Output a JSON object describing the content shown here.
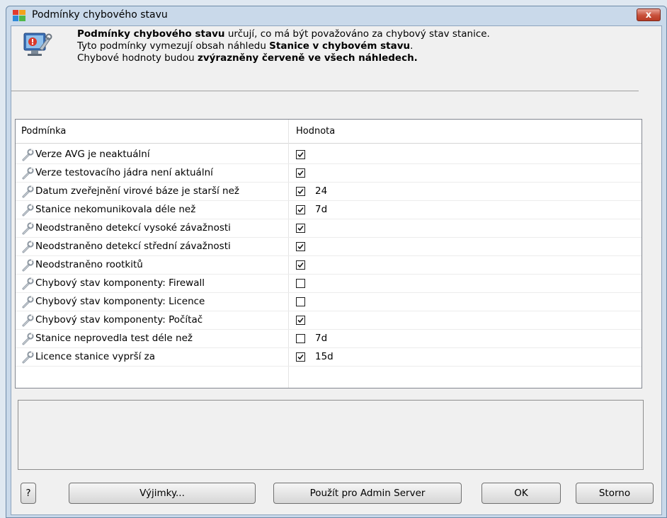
{
  "window": {
    "title": "Podmínky chybového stavu",
    "close_symbol": "x"
  },
  "intro": {
    "line1_bold": "Podmínky chybového stavu",
    "line1_rest": " určují, co má být považováno za chybový stav stanice.",
    "line2_rest": "Tyto podmínky vymezují obsah náhledu ",
    "line2_bold": "Stanice v chybovém stavu",
    "line2_end": ".",
    "line3_rest": "Chybové hodnoty budou ",
    "line3_bold": "zvýrazněny červeně ve všech náhledech."
  },
  "table": {
    "columns": [
      "Podmínka",
      "Hodnota"
    ],
    "rows": [
      {
        "condition": "Verze AVG je neaktuální",
        "checked": true,
        "value": ""
      },
      {
        "condition": "Verze testovacího jádra není aktuální",
        "checked": true,
        "value": ""
      },
      {
        "condition": "Datum zveřejnění virové báze je starší než",
        "checked": true,
        "value": "24"
      },
      {
        "condition": "Stanice nekomunikovala déle než",
        "checked": true,
        "value": "7d"
      },
      {
        "condition": "Neodstraněno detekcí vysoké závažnosti",
        "checked": true,
        "value": ""
      },
      {
        "condition": "Neodstraněno detekcí střední závažnosti",
        "checked": true,
        "value": ""
      },
      {
        "condition": "Neodstraněno rootkitů",
        "checked": true,
        "value": ""
      },
      {
        "condition": "Chybový stav komponenty: Firewall",
        "checked": false,
        "value": ""
      },
      {
        "condition": "Chybový stav komponenty: Licence",
        "checked": false,
        "value": ""
      },
      {
        "condition": "Chybový stav komponenty: Počítač",
        "checked": true,
        "value": ""
      },
      {
        "condition": "Stanice neprovedla test déle než",
        "checked": false,
        "value": "7d"
      },
      {
        "condition": "Licence stanice vyprší za",
        "checked": true,
        "value": "15d"
      }
    ]
  },
  "buttons": {
    "help": "?",
    "exceptions": "Výjimky...",
    "use_admin": "Použít pro Admin Server",
    "ok": "OK",
    "cancel": "Storno"
  },
  "icons": {
    "app": "avg-logo-icon",
    "header": "monitor-wrench-icon",
    "row": "wrench-icon"
  },
  "colors": {
    "window_frame": "#c9d9ea",
    "close_button": "#c8503a",
    "dialog_bg": "#f0f0f0"
  }
}
